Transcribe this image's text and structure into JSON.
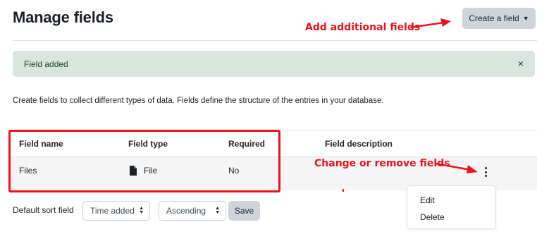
{
  "page": {
    "title": "Manage fields",
    "create_button_label": "Create a field"
  },
  "annotations": {
    "add": "Add additional fields",
    "change": "Change or remove fields"
  },
  "alert": {
    "message": "Field added",
    "close": "×"
  },
  "intro_text": "Create fields to collect different types of data. Fields define the structure of the entries in your database.",
  "table": {
    "headers": [
      "Field name",
      "Field type",
      "Required",
      "Field description"
    ],
    "rows": [
      {
        "name": "Files",
        "type": "File",
        "required": "No",
        "description": ""
      }
    ]
  },
  "actions_menu": {
    "items": [
      "Edit",
      "Delete"
    ]
  },
  "sort": {
    "label": "Default sort field",
    "field_value": "Time added",
    "order_value": "Ascending",
    "save_label": "Save"
  },
  "colors": {
    "annotation": "#e8141d",
    "alert_bg": "#d7e6de",
    "button_bg": "#ced4da"
  },
  "icons": [
    "chevron-down-icon",
    "close-icon",
    "file-icon",
    "kebab-menu-icon",
    "arrow-icon"
  ]
}
